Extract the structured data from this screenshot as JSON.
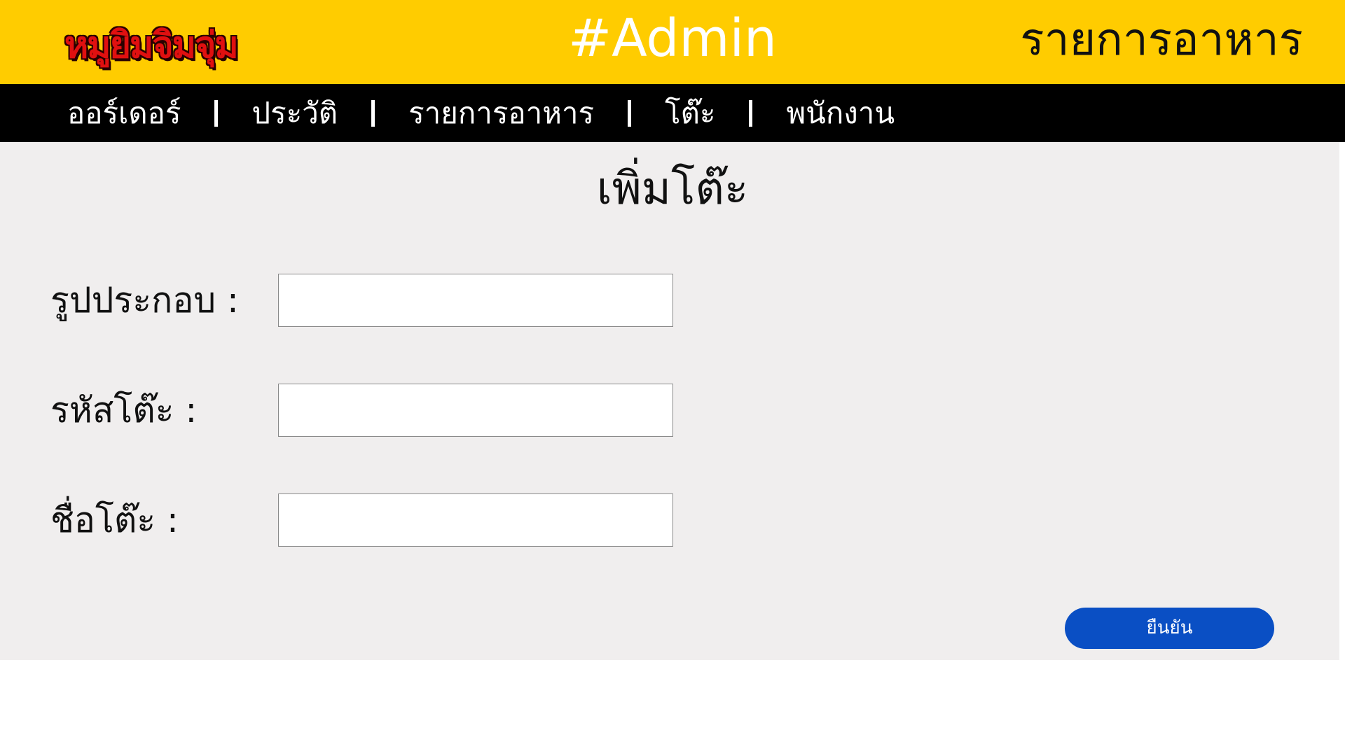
{
  "header": {
    "brand": "หมูยิมจิมจุ่ม",
    "role_title": "#Admin",
    "section_title": "รายการอาหาร"
  },
  "nav": {
    "items": [
      {
        "label": "ออร์เดอร์"
      },
      {
        "label": "ประวัติ"
      },
      {
        "label": "รายการอาหาร"
      },
      {
        "label": "โต๊ะ"
      },
      {
        "label": "พนักงาน"
      }
    ]
  },
  "form": {
    "title": "เพิ่มโต๊ะ",
    "fields": [
      {
        "label": "รูปประกอบ :",
        "value": "",
        "placeholder": ""
      },
      {
        "label": "รหัสโต๊ะ :",
        "value": "",
        "placeholder": ""
      },
      {
        "label": "ชื่อโต๊ะ :",
        "value": "",
        "placeholder": ""
      }
    ],
    "submit_label": "ยืนยัน"
  },
  "colors": {
    "header_bg": "#FFCC00",
    "nav_bg": "#000000",
    "content_bg": "#F0EEEE",
    "button_bg": "#0A4FC4",
    "brand_text": "#E01010"
  }
}
